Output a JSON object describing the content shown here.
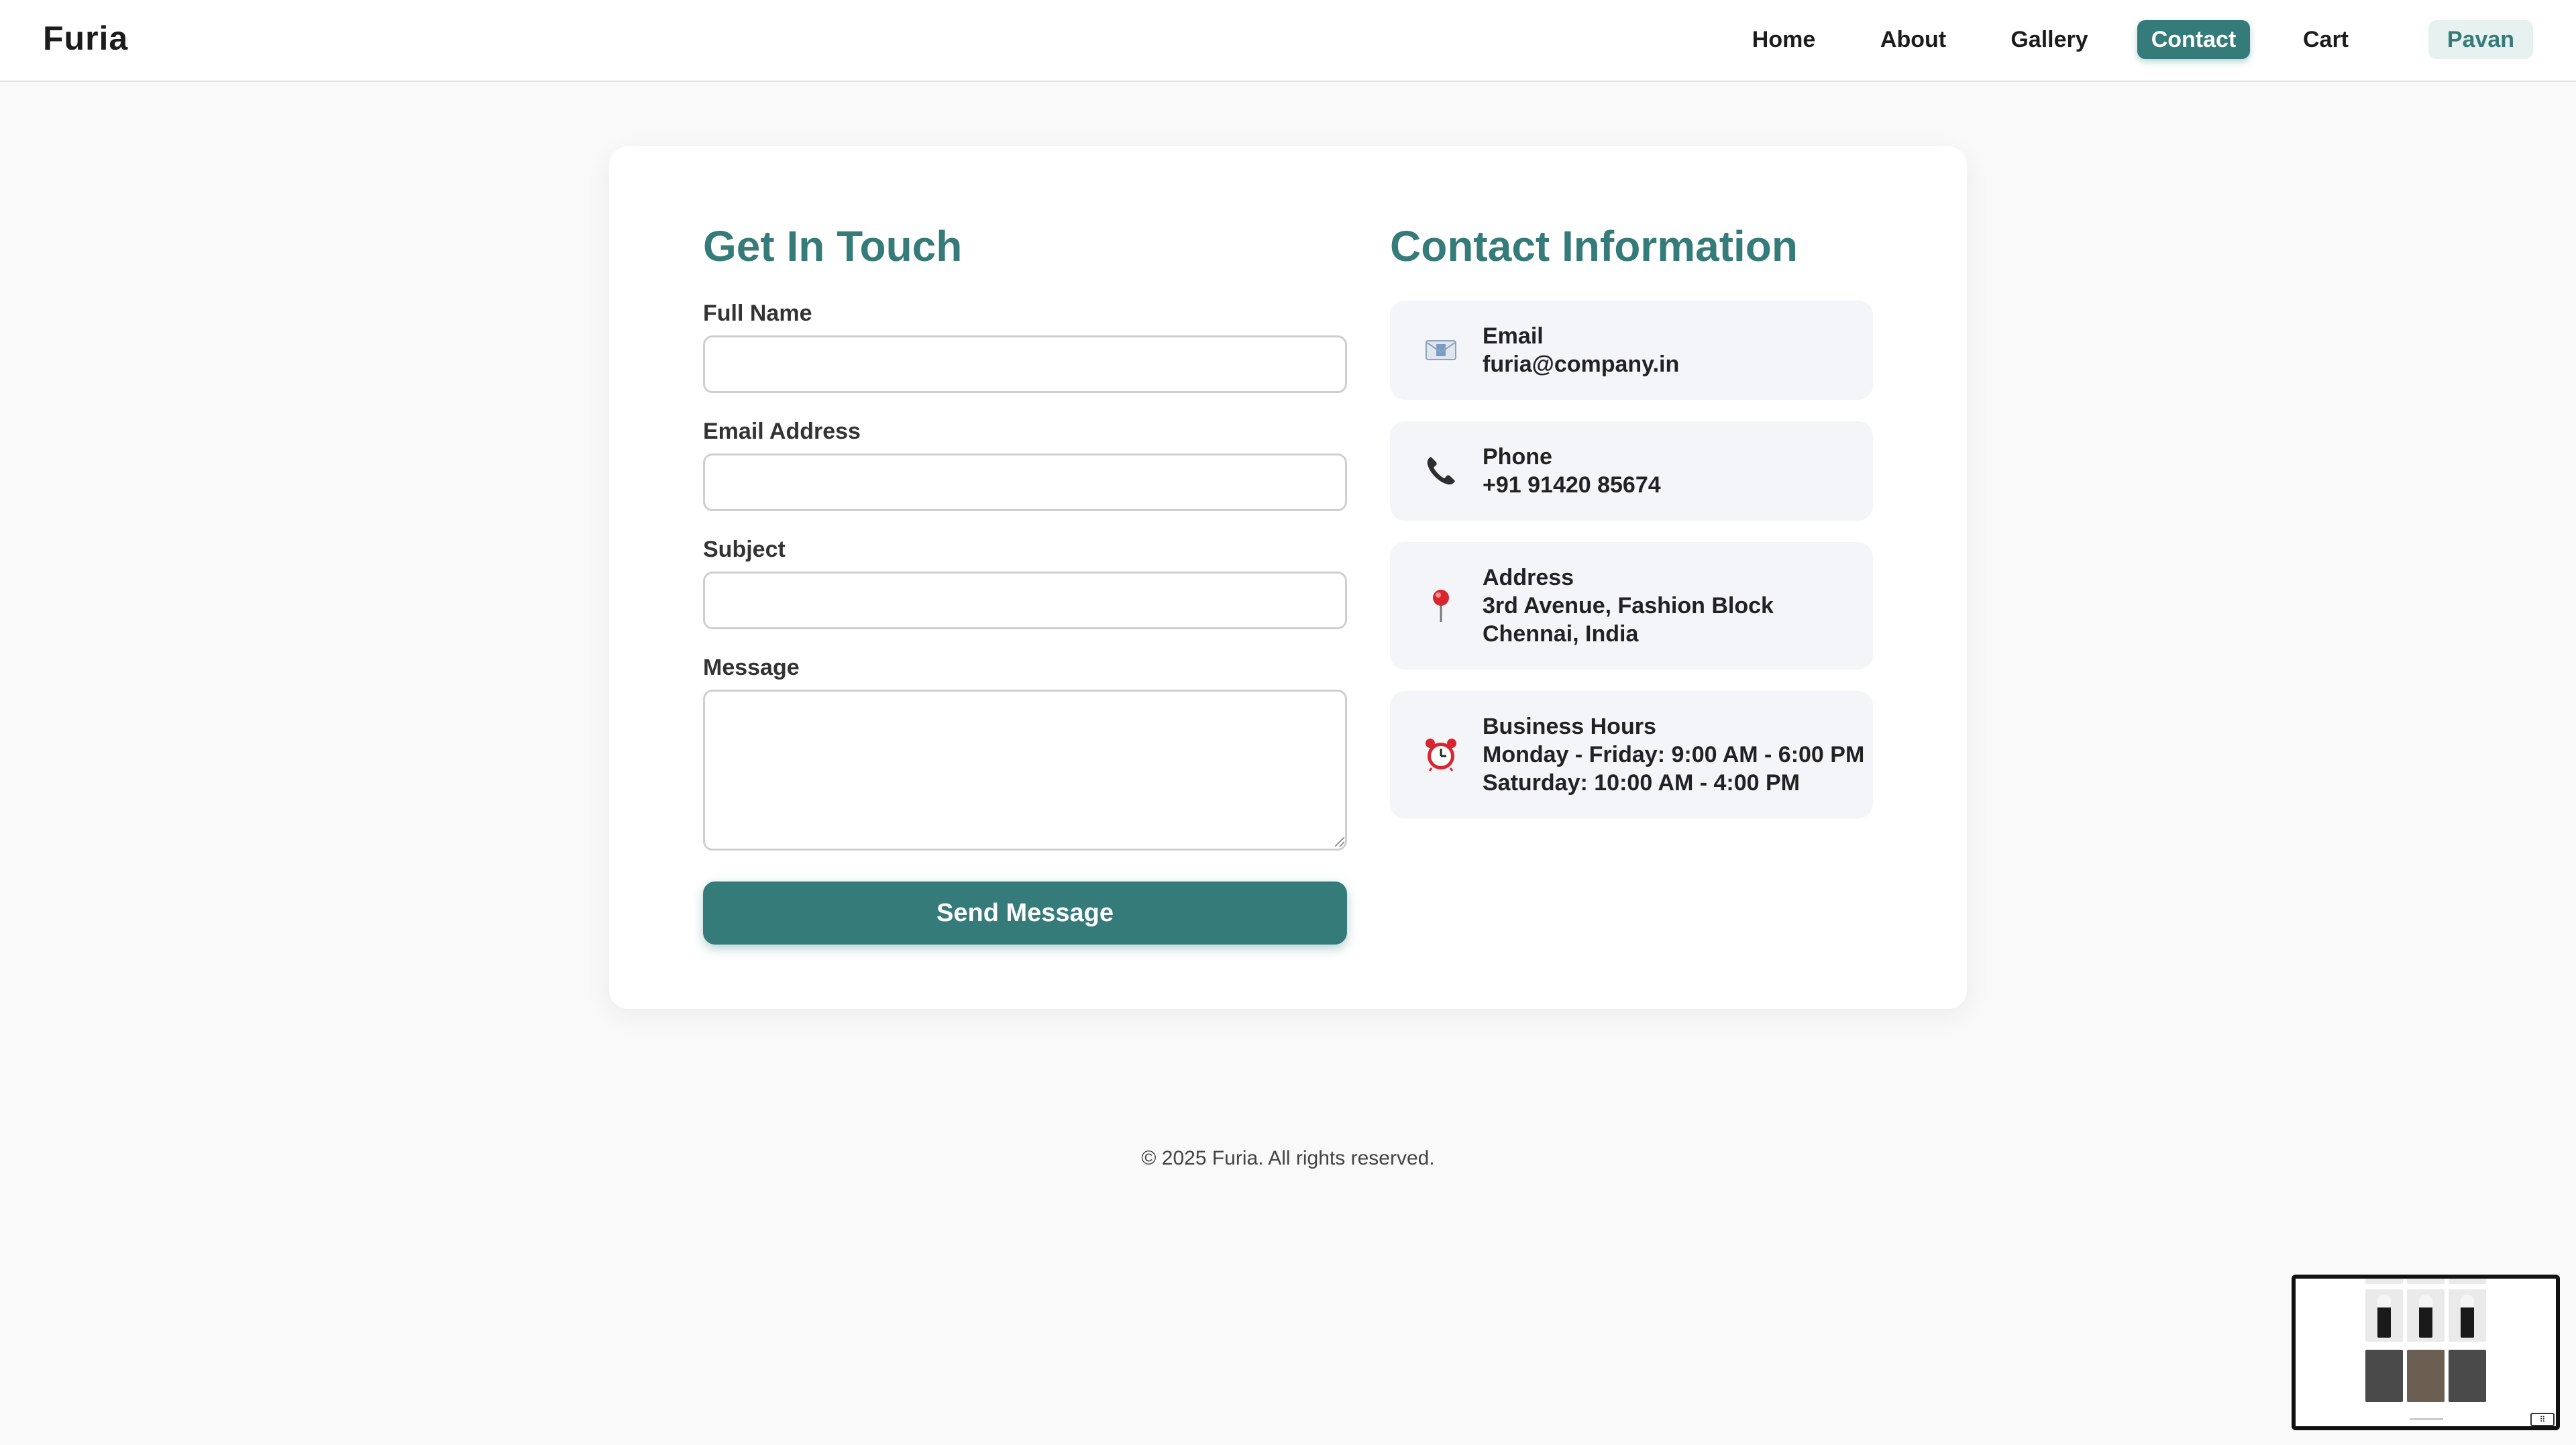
{
  "brand": "Furia",
  "nav": {
    "home": "Home",
    "about": "About",
    "gallery": "Gallery",
    "contact": "Contact",
    "cart": "Cart",
    "user": "Pavan",
    "active": "Contact"
  },
  "form": {
    "title": "Get In Touch",
    "full_name_label": "Full Name",
    "full_name_value": "",
    "email_label": "Email Address",
    "email_value": "",
    "subject_label": "Subject",
    "subject_value": "",
    "message_label": "Message",
    "message_value": "",
    "submit_label": "Send Message"
  },
  "contact_info": {
    "title": "Contact Information",
    "items": [
      {
        "icon": "envelope-icon",
        "label": "Email",
        "lines": [
          "furia@company.in"
        ]
      },
      {
        "icon": "phone-icon",
        "label": "Phone",
        "lines": [
          "+91 91420 85674"
        ]
      },
      {
        "icon": "map-pin-icon",
        "label": "Address",
        "lines": [
          "3rd Avenue, Fashion Block",
          "Chennai, India"
        ]
      },
      {
        "icon": "alarm-clock-icon",
        "label": "Business Hours",
        "lines": [
          "Monday - Friday: 9:00 AM - 6:00 PM",
          "Saturday: 10:00 AM - 4:00 PM"
        ]
      }
    ]
  },
  "footer": "© 2025 Furia. All rights reserved.",
  "colors": {
    "accent": "#347b7a",
    "accent_light": "#e7f1f0",
    "info_bg": "#f4f5f8",
    "page_bg": "#f9f9f9"
  }
}
